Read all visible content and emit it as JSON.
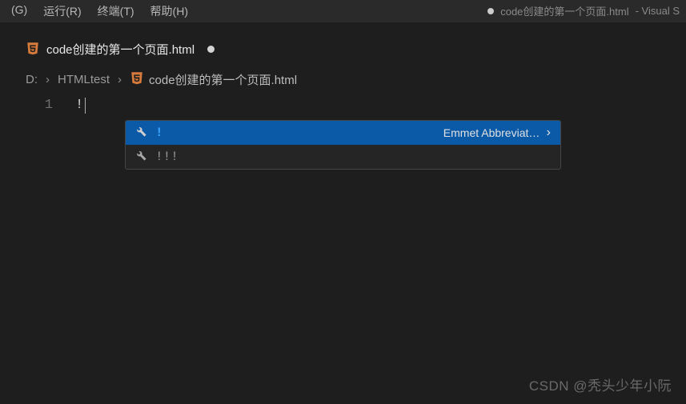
{
  "menubar": {
    "items": [
      "(G)",
      "运行(R)",
      "终端(T)",
      "帮助(H)"
    ]
  },
  "titlebar": {
    "file_label": "code创建的第一个页面.html",
    "app_suffix": " - Visual S"
  },
  "tab": {
    "label": "code创建的第一个页面.html"
  },
  "breadcrumbs": {
    "drive": "D:",
    "folder": "HTMLtest",
    "file": "code创建的第一个页面.html"
  },
  "editor": {
    "line_number": "1",
    "code_text": "!"
  },
  "suggest": {
    "items": [
      {
        "label": "!",
        "detail": "Emmet Abbreviat…",
        "selected": true
      },
      {
        "label": "!!!",
        "detail": "",
        "selected": false
      }
    ]
  },
  "watermark": "CSDN @秃头少年小阮"
}
